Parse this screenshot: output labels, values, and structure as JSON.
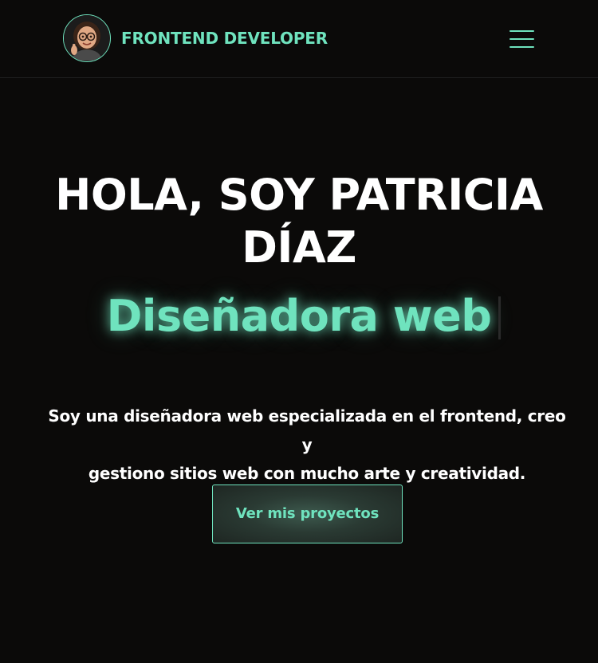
{
  "header": {
    "brand": "FRONTEND DEVELOPER",
    "avatar_icon": "avatar-memoji-thumbs-up",
    "menu_icon": "hamburger-menu-icon"
  },
  "hero": {
    "title_line1": "HOLA, SOY PATRICIA",
    "title_line2": "DÍAZ",
    "subtitle": "Diseñadora web",
    "description_line1": "Soy una diseñadora web especializada en el frontend, creo y",
    "description_line2": "gestiono sitios web con mucho arte y creatividad.",
    "cta_label": "Ver mis proyectos"
  },
  "colors": {
    "background": "#0b0a09",
    "accent": "#6fe3be",
    "text": "#ffffff"
  }
}
